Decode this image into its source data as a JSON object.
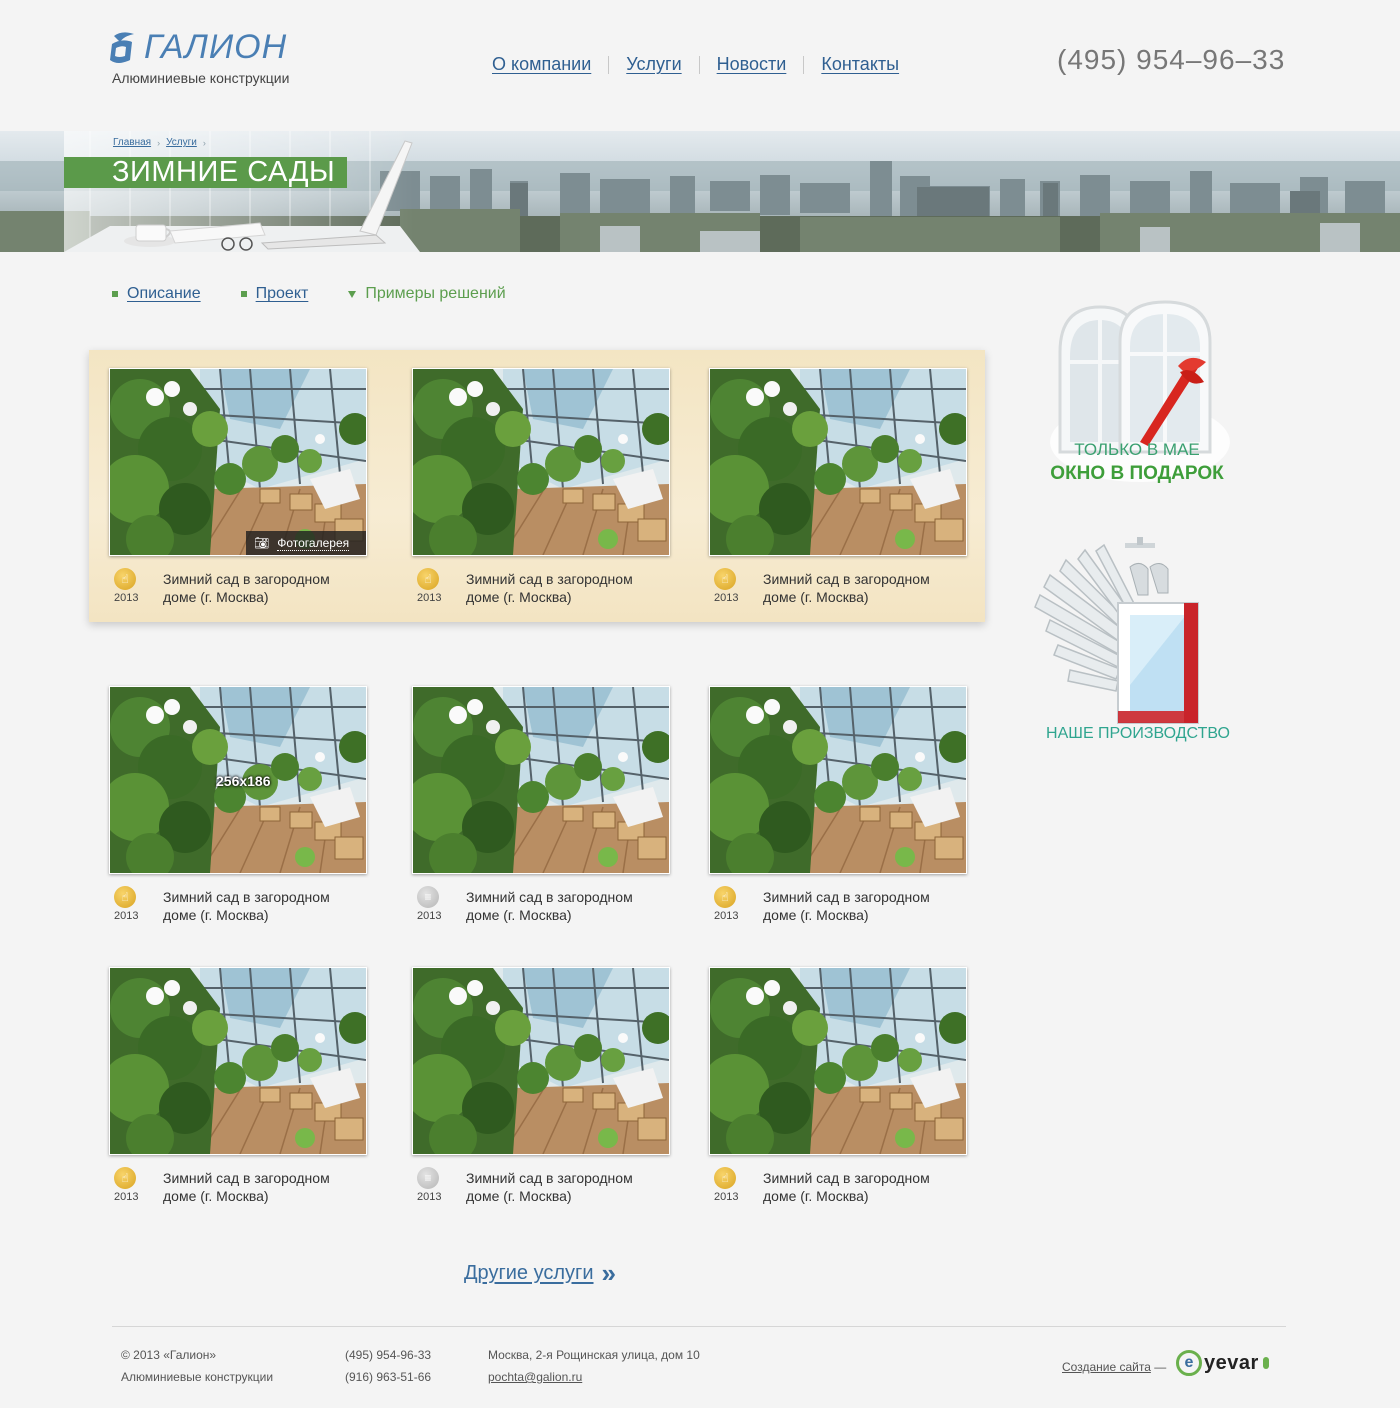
{
  "header": {
    "logo_name": "ГАЛИОН",
    "logo_sub": "Алюминиевые конструкции",
    "nav": [
      "О компании",
      "Услуги",
      "Новости",
      "Контакты"
    ],
    "phone": "(495) 954–96–33"
  },
  "banner": {
    "breadcrumbs": [
      "Главная",
      "Услуги"
    ],
    "title": "ЗИМНИЕ САДЫ"
  },
  "subtabs": {
    "description": "Описание",
    "project": "Проект",
    "examples": "Примеры решений"
  },
  "gallery": {
    "photo_gallery_label": "Фотогалерея",
    "thumb_size_label": "256x186",
    "items": [
      {
        "year": "2013",
        "caption": "Зимний сад в загородном доме (г. Москва)",
        "badge": "gold"
      },
      {
        "year": "2013",
        "caption": "Зимний сад в загородном доме (г. Москва)",
        "badge": "gold"
      },
      {
        "year": "2013",
        "caption": "Зимний сад в загородном доме (г. Москва)",
        "badge": "gold"
      },
      {
        "year": "2013",
        "caption": "Зимний сад в загородном доме (г. Москва)",
        "badge": "gold"
      },
      {
        "year": "2013",
        "caption": "Зимний сад в загородном доме (г. Москва)",
        "badge": "grey"
      },
      {
        "year": "2013",
        "caption": "Зимний сад в загородном доме (г. Москва)",
        "badge": "gold"
      },
      {
        "year": "2013",
        "caption": "Зимний сад в загородном доме (г. Москва)",
        "badge": "gold"
      },
      {
        "year": "2013",
        "caption": "Зимний сад в загородном доме (г. Москва)",
        "badge": "grey"
      },
      {
        "year": "2013",
        "caption": "Зимний сад в загородном доме (г. Москва)",
        "badge": "gold"
      }
    ]
  },
  "sidebar": {
    "promo1_line1": "ТОЛЬКО В МАЕ",
    "promo1_line2": "ОКНО В ПОДАРОК",
    "promo2_label": "НАШЕ ПРОИЗВОДСТВО"
  },
  "more_link": "Другие услуги",
  "footer": {
    "copyright": "© 2013  «Галион»",
    "company_sub": "Алюминиевые конструкции",
    "phone1": "(495) 954-96-33",
    "phone2": "(916) 963-51-66",
    "address": "Москва, 2-я Рощинская улица, дом 10",
    "email": "pochta@galion.ru",
    "credit": "Создание сайта",
    "credit_sep": "—",
    "credit_brand": "yevar"
  },
  "colors": {
    "brand_blue": "#4a7fb4",
    "link_blue": "#2f5f91",
    "accent_green": "#5b9a4a",
    "highlight_bg": "#f3e5c3",
    "badge_gold": "#e3b02e",
    "badge_grey": "#bdbdbd"
  },
  "icons": {
    "logo": "sail-icon",
    "gallery": "camera-icon",
    "badge_gold": "thumbs-up-icon",
    "badge_grey": "neutral-icon",
    "more": "double-chevron-right-icon"
  }
}
